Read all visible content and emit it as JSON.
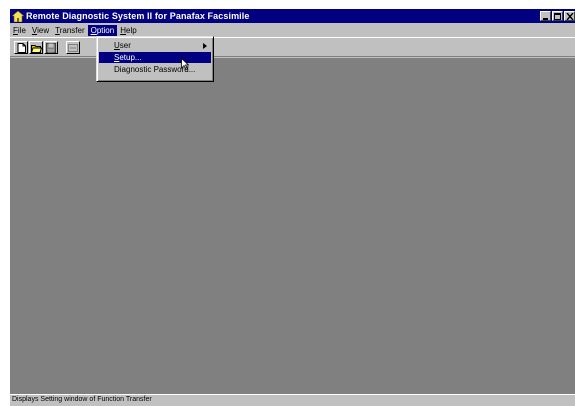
{
  "window": {
    "title": "Remote Diagnostic System II for Panafax Facsimile"
  },
  "menubar": {
    "items": [
      {
        "label": "File",
        "accel": "F",
        "rest": "ile"
      },
      {
        "label": "View",
        "accel": "V",
        "rest": "iew"
      },
      {
        "label": "Transfer",
        "accel": "T",
        "rest": "ransfer"
      },
      {
        "label": "Option",
        "accel": "O",
        "rest": "ption"
      },
      {
        "label": "Help",
        "accel": "H",
        "rest": "elp"
      }
    ],
    "active": "Option"
  },
  "toolbar": {
    "buttons": [
      "new-file-icon",
      "open-folder-icon",
      "save-disk-icon",
      "transfer-icon"
    ]
  },
  "option_menu": {
    "items": [
      {
        "label": "User...",
        "accel": "U",
        "rest": "ser",
        "has_submenu": true
      },
      {
        "label": "Setup...",
        "accel": "S",
        "rest": "etup...",
        "highlighted": true
      },
      {
        "label": "Diagnostic Password...",
        "accel": "",
        "rest": "Diagnostic Password..."
      }
    ]
  },
  "statusbar": {
    "text": "Displays Setting window of Function Transfer"
  },
  "colors": {
    "titlebar": "#000080",
    "workspace": "#808080",
    "chrome": "#c0c0c0",
    "highlight": "#000080"
  }
}
